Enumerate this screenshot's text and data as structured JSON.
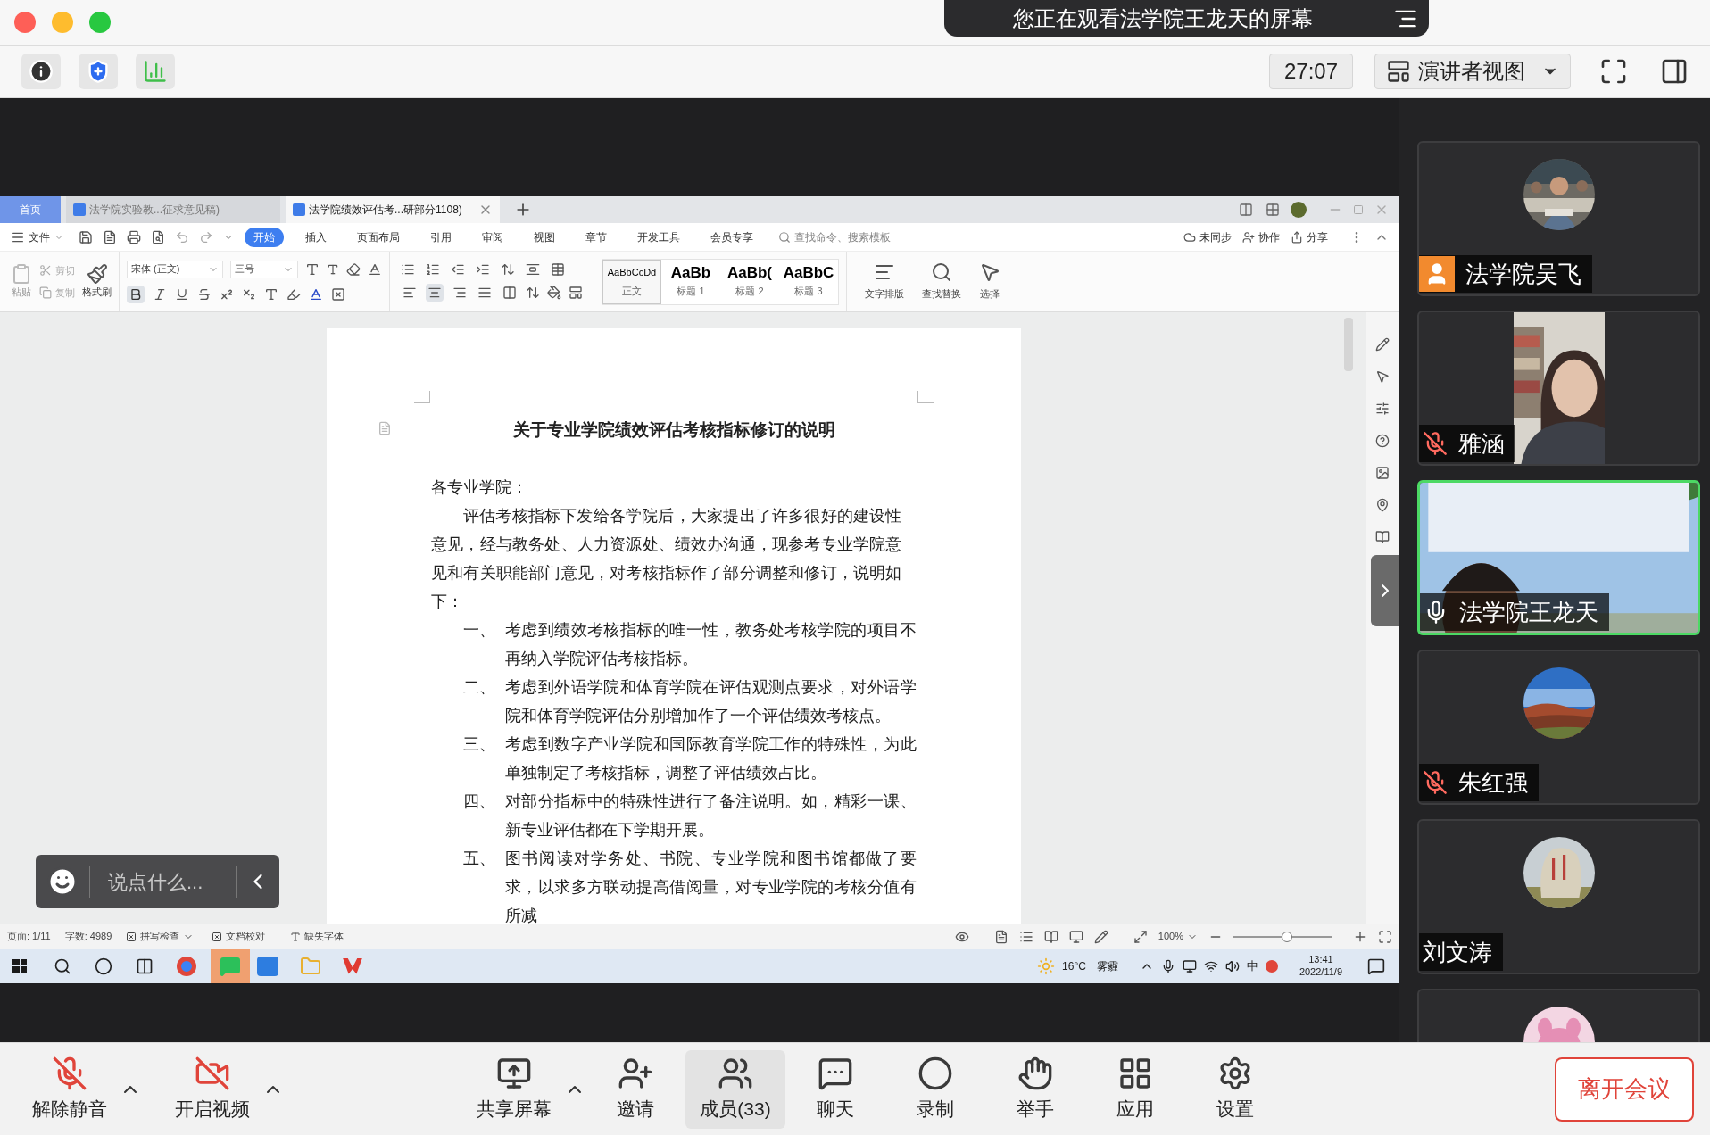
{
  "banner": {
    "text": "您正在观看法学院王龙天的屏幕"
  },
  "top_toolbar": {
    "timer": "27:07",
    "view_menu": "演讲者视图"
  },
  "shared_screen": {
    "tabs": [
      {
        "label": "首页",
        "kind": "home",
        "selected": false
      },
      {
        "label": "法学院实验教...征求意见稿)",
        "kind": "doc",
        "selected": false
      },
      {
        "label": "法学院绩效评估考...研部分1108)",
        "kind": "doc",
        "selected": true
      }
    ],
    "file_menu": "文件",
    "ribbon_tabs": [
      {
        "label": "开始",
        "selected": true
      },
      {
        "label": "插入",
        "selected": false
      },
      {
        "label": "页面布局",
        "selected": false
      },
      {
        "label": "引用",
        "selected": false
      },
      {
        "label": "审阅",
        "selected": false
      },
      {
        "label": "视图",
        "selected": false
      },
      {
        "label": "章节",
        "selected": false
      },
      {
        "label": "开发工具",
        "selected": false
      },
      {
        "label": "会员专享",
        "selected": false
      }
    ],
    "command_search": {
      "placeholder": "查找命令、搜索模板"
    },
    "actions": [
      {
        "label": "未同步",
        "kind": "sync"
      },
      {
        "label": "协作",
        "kind": "collab"
      },
      {
        "label": "分享",
        "kind": "share"
      }
    ],
    "clipboard": {
      "paste": "粘贴",
      "cut": "剪切",
      "copy": "复制",
      "format_painter": "格式刷"
    },
    "font": {
      "family": "宋体 (正文)",
      "size": "三号",
      "bold": true
    },
    "alignment": [
      {
        "kind": "left",
        "selected": false
      },
      {
        "kind": "center",
        "selected": true
      },
      {
        "kind": "right",
        "selected": false
      },
      {
        "kind": "justify",
        "selected": false
      },
      {
        "kind": "distributed",
        "selected": false
      }
    ],
    "styles": [
      {
        "sample": "AaBbCcDd",
        "label": "正文",
        "selected": true
      },
      {
        "sample": "AaBb",
        "label": "标题 1",
        "selected": false
      },
      {
        "sample": "AaBb(",
        "label": "标题 2",
        "selected": false
      },
      {
        "sample": "AaBbC",
        "label": "标题 3",
        "selected": false
      }
    ],
    "tools": [
      {
        "label": "文字排版",
        "kind": "layout"
      },
      {
        "label": "查找替换",
        "kind": "find"
      },
      {
        "label": "选择",
        "kind": "select"
      }
    ],
    "document": {
      "title": "关于专业学院绩效评估考核指标修订的说明",
      "salutation": "各专业学院：",
      "paragraph": "评估考核指标下发给各学院后，大家提出了许多很好的建设性意见，经与教务处、人力资源处、绩效办沟通，现参考专业学院意见和有关职能部门意见，对考核指标作了部分调整和修订，说明如下：",
      "items": [
        {
          "number": "一、",
          "text": "考虑到绩效考核指标的唯一性，教务处考核学院的项目不再纳入学院评估考核指标。"
        },
        {
          "number": "二、",
          "text": "考虑到外语学院和体育学院在评估观测点要求，对外语学院和体育学院评估分别增加作了一个评估绩效考核点。"
        },
        {
          "number": "三、",
          "text": "考虑到数字产业学院和国际教育学院工作的特殊性，为此单独制定了考核指标，调整了评估绩效占比。"
        },
        {
          "number": "四、",
          "text": "对部分指标中的特殊性进行了备注说明。如，精彩一课、新专业评估都在下学期开展。"
        },
        {
          "number": "五、",
          "text": "图书阅读对学务处、书院、专业学院和图书馆都做了要求，以求多方联动提高借阅量，对专业学院的考核分值有所减"
        }
      ]
    },
    "status_bar": {
      "page": "页面: 1/11",
      "words": "字数: 4989",
      "spell_check": "拼写检查",
      "proofread": "文档校对",
      "missing_fonts": "缺失字体",
      "zoom": "100%",
      "zoom_slider": {
        "level": 0.55
      }
    },
    "taskbar": {
      "temperature": "16°C",
      "weather": "雾霾",
      "ime": "中",
      "time": "13:41",
      "date": "2022/11/9"
    },
    "chat_input": {
      "placeholder": "说点什么..."
    }
  },
  "participants": [
    {
      "name": "法学院吴飞",
      "kind": "avatar",
      "host": true,
      "speaking": false
    },
    {
      "name": "雅涵",
      "kind": "portrait_video",
      "host": false,
      "muted": true,
      "speaking": false
    },
    {
      "name": "法学院王龙天",
      "kind": "video",
      "host": false,
      "muted": false,
      "speaking": true
    },
    {
      "name": "朱红强",
      "kind": "avatar",
      "host": false,
      "muted": true,
      "speaking": false
    },
    {
      "name": "刘文涛",
      "kind": "avatar",
      "host": false,
      "speaking": false
    },
    {
      "kind": "avatar",
      "host": false,
      "speaking": false
    }
  ],
  "controls": [
    {
      "label": "解除静音",
      "kind": "mic_off",
      "caret": true,
      "selected": false
    },
    {
      "label": "开启视频",
      "kind": "video_off",
      "caret": true,
      "selected": false
    },
    {
      "label": "共享屏幕",
      "kind": "share",
      "caret": true,
      "selected": false
    },
    {
      "label": "邀请",
      "kind": "invite",
      "caret": false,
      "selected": false
    },
    {
      "label": "成员(33)",
      "kind": "members",
      "caret": false,
      "selected": true
    },
    {
      "label": "聊天",
      "kind": "chat",
      "caret": false,
      "selected": false
    },
    {
      "label": "录制",
      "kind": "record",
      "caret": false,
      "selected": false
    },
    {
      "label": "举手",
      "kind": "hand",
      "caret": false,
      "selected": false
    },
    {
      "label": "应用",
      "kind": "apps",
      "caret": false,
      "selected": false
    },
    {
      "label": "设置",
      "kind": "settings",
      "caret": false,
      "selected": false
    }
  ],
  "leave_button": "离开会议"
}
